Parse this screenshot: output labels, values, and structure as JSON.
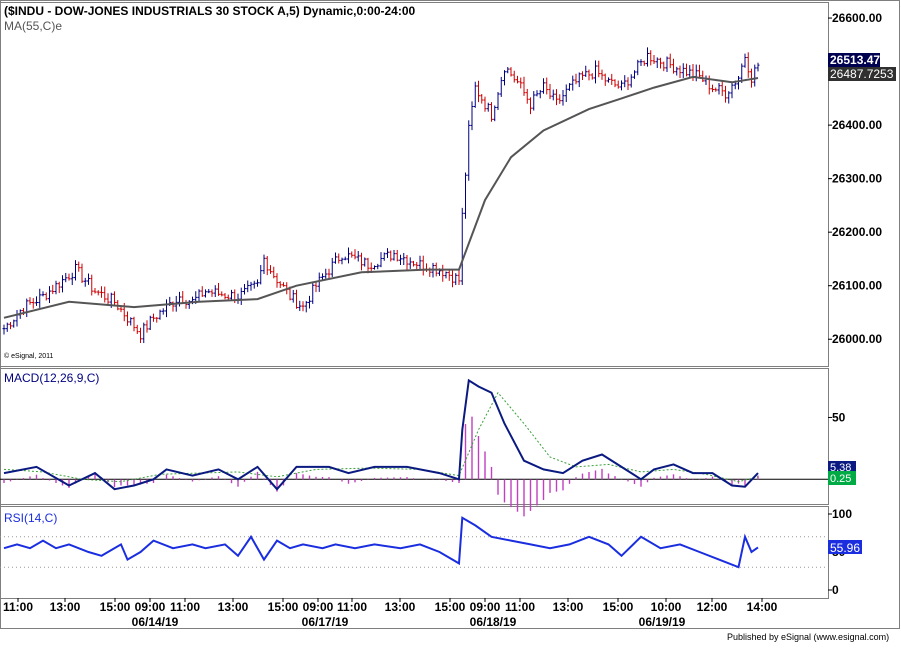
{
  "colors": {
    "background": "#ffffff",
    "frame": "#7f7f7f",
    "price_up": "#000080",
    "price_down": "#cc0000",
    "ma_line": "#555555",
    "macd_line": "#0a1a80",
    "macd_signal": "#3aa03a",
    "macd_hist": "#c040c0",
    "rsi_line": "#1a2ee0",
    "last_price_bg": "#000050",
    "ma_value_bg": "#303030",
    "macd_value_bg": "#00aa44",
    "rsi_value_bg": "#1a2ee0"
  },
  "header": {
    "price_title": "($INDU - DOW-JONES INDUSTRIALS 30 STOCK A,5) Dynamic,0:00-24:00",
    "ma_label": "MA(55,C)e",
    "watermark": "© eSignal, 2011",
    "macd_title": "MACD(12,26,9,C)",
    "rsi_title": "RSI(14,C)",
    "published": "Published by eSignal (www.esignal.com)"
  },
  "value_boxes": {
    "last_price": "26513.47",
    "ma_value": "26487.7253",
    "macd_value": "5.38",
    "signal_value": "0.25",
    "rsi_value": "55.96"
  },
  "price_axis_labels": [
    "26600.00",
    "26500.00",
    "26400.00",
    "26300.00",
    "26200.00",
    "26100.00",
    "26000.00"
  ],
  "macd_axis_labels": [
    "50"
  ],
  "rsi_axis_labels": [
    "100",
    "50",
    "0"
  ],
  "time_labels": [
    "11:00",
    "13:00",
    "15:00",
    "09:00",
    "11:00",
    "13:00",
    "15:00",
    "09:00",
    "11:00",
    "13:00",
    "15:00",
    "09:00",
    "11:00",
    "13:00",
    "15:00",
    "10:00",
    "12:00",
    "14:00"
  ],
  "date_labels": [
    "06/14/19",
    "06/17/19",
    "06/18/19",
    "06/19/19"
  ],
  "chart_data": [
    {
      "type": "line",
      "panel": "price",
      "chart_kind": "OHLC bars, 5-minute",
      "title": "($INDU - DOW-JONES INDUSTRIALS 30 STOCK A,5) Dynamic,0:00-24:00",
      "ylim": [
        25950,
        26630
      ],
      "grid": false,
      "y_ticks": [
        26000,
        26100,
        26200,
        26300,
        26400,
        26500,
        26600
      ],
      "x_time_ticks": [
        "11:00",
        "13:00",
        "15:00",
        "09:00",
        "11:00",
        "13:00",
        "15:00",
        "09:00",
        "11:00",
        "13:00",
        "15:00",
        "09:00",
        "11:00",
        "13:00",
        "15:00",
        "10:00",
        "12:00",
        "14:00"
      ],
      "x_dates": [
        "06/14/19",
        "06/17/19",
        "06/18/19",
        "06/19/19"
      ],
      "close_path": [
        [
          0,
          26020
        ],
        [
          6,
          26060
        ],
        [
          12,
          26080
        ],
        [
          18,
          26110
        ],
        [
          22,
          26130
        ],
        [
          28,
          26090
        ],
        [
          34,
          26070
        ],
        [
          38,
          26040
        ],
        [
          42,
          26010
        ],
        [
          46,
          26040
        ],
        [
          50,
          26060
        ],
        [
          54,
          26080
        ],
        [
          58,
          26070
        ],
        [
          62,
          26090
        ],
        [
          66,
          26085
        ],
        [
          72,
          26080
        ],
        [
          78,
          26100
        ],
        [
          80,
          26150
        ],
        [
          83,
          26120
        ],
        [
          88,
          26080
        ],
        [
          92,
          26060
        ],
        [
          96,
          26100
        ],
        [
          100,
          26130
        ],
        [
          104,
          26160
        ],
        [
          108,
          26150
        ],
        [
          112,
          26140
        ],
        [
          116,
          26150
        ],
        [
          120,
          26160
        ],
        [
          124,
          26150
        ],
        [
          128,
          26140
        ],
        [
          132,
          26135
        ],
        [
          136,
          26125
        ],
        [
          140,
          26110
        ],
        [
          141,
          26230
        ],
        [
          143,
          26390
        ],
        [
          145,
          26470
        ],
        [
          150,
          26420
        ],
        [
          154,
          26510
        ],
        [
          158,
          26480
        ],
        [
          162,
          26440
        ],
        [
          166,
          26470
        ],
        [
          170,
          26440
        ],
        [
          174,
          26470
        ],
        [
          178,
          26490
        ],
        [
          182,
          26500
        ],
        [
          186,
          26480
        ],
        [
          190,
          26470
        ],
        [
          194,
          26500
        ],
        [
          198,
          26530
        ],
        [
          202,
          26520
        ],
        [
          206,
          26510
        ],
        [
          210,
          26500
        ],
        [
          214,
          26490
        ],
        [
          218,
          26470
        ],
        [
          222,
          26460
        ],
        [
          226,
          26490
        ],
        [
          228,
          26530
        ],
        [
          230,
          26490
        ],
        [
          232,
          26513
        ]
      ],
      "series": [
        {
          "name": "MA(55,C)e",
          "points": [
            [
              0,
              26040
            ],
            [
              20,
              26070
            ],
            [
              40,
              26060
            ],
            [
              60,
              26070
            ],
            [
              78,
              26075
            ],
            [
              90,
              26100
            ],
            [
              110,
              26125
            ],
            [
              130,
              26130
            ],
            [
              140,
              26130
            ],
            [
              148,
              26260
            ],
            [
              156,
              26340
            ],
            [
              166,
              26390
            ],
            [
              180,
              26430
            ],
            [
              190,
              26450
            ],
            [
              200,
              26470
            ],
            [
              212,
              26490
            ],
            [
              224,
              26480
            ],
            [
              232,
              26488
            ]
          ]
        }
      ]
    },
    {
      "type": "line",
      "panel": "macd",
      "title": "MACD(12,26,9,C)",
      "y_ticks": [
        50
      ],
      "ylim": [
        -20,
        90
      ],
      "grid": false,
      "zero_line": 0,
      "macd": [
        [
          0,
          5
        ],
        [
          10,
          10
        ],
        [
          20,
          -5
        ],
        [
          28,
          5
        ],
        [
          34,
          -8
        ],
        [
          40,
          -5
        ],
        [
          46,
          0
        ],
        [
          50,
          8
        ],
        [
          58,
          3
        ],
        [
          66,
          8
        ],
        [
          72,
          0
        ],
        [
          78,
          10
        ],
        [
          84,
          -8
        ],
        [
          90,
          10
        ],
        [
          100,
          10
        ],
        [
          106,
          5
        ],
        [
          114,
          10
        ],
        [
          124,
          10
        ],
        [
          134,
          5
        ],
        [
          140,
          0
        ],
        [
          141,
          40
        ],
        [
          143,
          80
        ],
        [
          146,
          75
        ],
        [
          150,
          70
        ],
        [
          154,
          45
        ],
        [
          160,
          15
        ],
        [
          166,
          8
        ],
        [
          172,
          5
        ],
        [
          178,
          15
        ],
        [
          184,
          20
        ],
        [
          190,
          10
        ],
        [
          196,
          0
        ],
        [
          200,
          8
        ],
        [
          206,
          12
        ],
        [
          212,
          5
        ],
        [
          218,
          5
        ],
        [
          224,
          -5
        ],
        [
          228,
          -6
        ],
        [
          232,
          5
        ]
      ],
      "signal": [
        [
          0,
          8
        ],
        [
          12,
          6
        ],
        [
          24,
          0
        ],
        [
          36,
          -2
        ],
        [
          48,
          4
        ],
        [
          60,
          5
        ],
        [
          72,
          6
        ],
        [
          84,
          2
        ],
        [
          96,
          8
        ],
        [
          112,
          9
        ],
        [
          128,
          8
        ],
        [
          140,
          3
        ],
        [
          146,
          40
        ],
        [
          152,
          70
        ],
        [
          160,
          45
        ],
        [
          168,
          18
        ],
        [
          176,
          10
        ],
        [
          186,
          12
        ],
        [
          196,
          6
        ],
        [
          206,
          8
        ],
        [
          216,
          4
        ],
        [
          226,
          -2
        ],
        [
          232,
          2
        ]
      ],
      "histogram_peak_value": 60,
      "last_values": {
        "macd": 5.38,
        "signal": 0.25
      }
    },
    {
      "type": "line",
      "panel": "rsi",
      "title": "RSI(14,C)",
      "ylim": [
        0,
        100
      ],
      "y_ticks": [
        100,
        50,
        0
      ],
      "grid": false,
      "reference_levels": [
        70,
        30
      ],
      "values": [
        [
          0,
          55
        ],
        [
          4,
          60
        ],
        [
          8,
          55
        ],
        [
          12,
          65
        ],
        [
          16,
          55
        ],
        [
          20,
          60
        ],
        [
          26,
          50
        ],
        [
          30,
          45
        ],
        [
          36,
          60
        ],
        [
          38,
          40
        ],
        [
          42,
          50
        ],
        [
          46,
          65
        ],
        [
          52,
          55
        ],
        [
          58,
          60
        ],
        [
          62,
          55
        ],
        [
          68,
          60
        ],
        [
          72,
          45
        ],
        [
          76,
          70
        ],
        [
          80,
          40
        ],
        [
          84,
          65
        ],
        [
          88,
          55
        ],
        [
          92,
          60
        ],
        [
          98,
          55
        ],
        [
          102,
          60
        ],
        [
          108,
          55
        ],
        [
          114,
          60
        ],
        [
          122,
          55
        ],
        [
          128,
          60
        ],
        [
          134,
          50
        ],
        [
          140,
          35
        ],
        [
          141,
          95
        ],
        [
          145,
          85
        ],
        [
          150,
          70
        ],
        [
          156,
          65
        ],
        [
          162,
          60
        ],
        [
          168,
          55
        ],
        [
          174,
          60
        ],
        [
          180,
          70
        ],
        [
          186,
          60
        ],
        [
          190,
          45
        ],
        [
          196,
          70
        ],
        [
          202,
          55
        ],
        [
          208,
          60
        ],
        [
          214,
          50
        ],
        [
          220,
          40
        ],
        [
          226,
          30
        ],
        [
          228,
          70
        ],
        [
          230,
          50
        ],
        [
          232,
          56
        ]
      ],
      "last_value": 55.96
    }
  ]
}
